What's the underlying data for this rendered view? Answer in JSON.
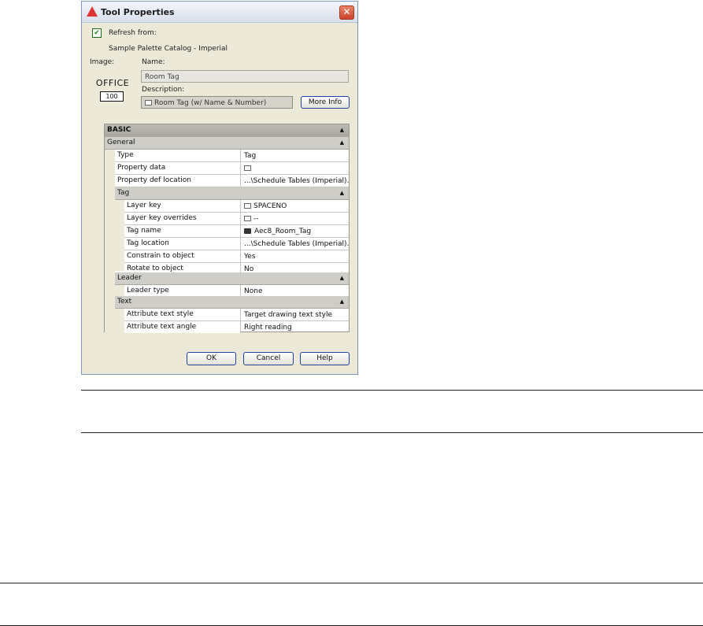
{
  "window": {
    "title": "Tool Properties",
    "close_glyph": "✕"
  },
  "refresh": {
    "checked": true,
    "label": "Refresh from:",
    "source": "Sample Palette Catalog - Imperial"
  },
  "image": {
    "label": "Image:",
    "preview_text": "OFFICE",
    "preview_scale": "100"
  },
  "name": {
    "label": "Name:",
    "value": "Room Tag"
  },
  "description": {
    "label": "Description:",
    "value": "Room Tag (w/ Name & Number)"
  },
  "more_info_button": "More Info",
  "grid": {
    "basic": "BASIC",
    "general": "General",
    "type_label": "Type",
    "type_value": "Tag",
    "property_data_label": "Property data",
    "property_def_label": "Property def location",
    "property_def_value": "...\\Schedule Tables (Imperial)...",
    "tag": "Tag",
    "layer_key_label": "Layer key",
    "layer_key_value": "SPACENO",
    "layer_key_overrides_label": "Layer key overrides",
    "layer_key_overrides_value": "--",
    "tag_name_label": "Tag name",
    "tag_name_value": "Aec8_Room_Tag",
    "tag_location_label": "Tag location",
    "tag_location_value": "...\\Schedule Tables (Imperial)...",
    "constrain_label": "Constrain to object",
    "constrain_value": "Yes",
    "rotate_label": "Rotate to object",
    "rotate_value": "No",
    "leader": "Leader",
    "leader_type_label": "Leader type",
    "leader_type_value": "None",
    "text": "Text",
    "attr_style_label": "Attribute text style",
    "attr_style_value": "Target drawing text style",
    "attr_angle_label": "Attribute text angle",
    "attr_angle_value": "Right reading",
    "collapse_glyph": "▲"
  },
  "buttons": {
    "ok": "OK",
    "cancel": "Cancel",
    "help": "Help"
  }
}
